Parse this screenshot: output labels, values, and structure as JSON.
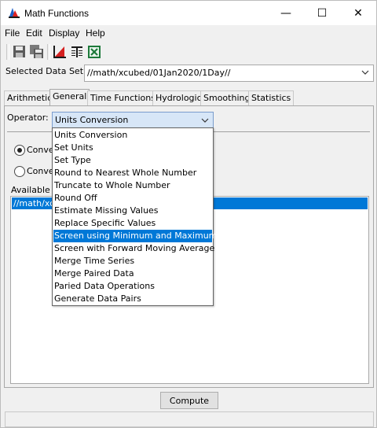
{
  "window": {
    "title": "Math Functions",
    "minimize": "—",
    "maximize": "☐",
    "close": "✕"
  },
  "menu": [
    "File",
    "Edit",
    "Display",
    "Help"
  ],
  "data_set": {
    "label": "Selected Data Set:",
    "value": "//math/xcubed/01Jan2020/1Day//"
  },
  "tabs": [
    {
      "label": "Arithmetic",
      "active": false
    },
    {
      "label": "General",
      "active": true
    },
    {
      "label": "Time Functions",
      "active": false
    },
    {
      "label": "Hydrologic",
      "active": false
    },
    {
      "label": "Smoothing",
      "active": false
    },
    {
      "label": "Statistics",
      "active": false
    }
  ],
  "operator": {
    "label": "Operator:",
    "value": "Units Conversion",
    "options": [
      "Units Conversion",
      "Set Units",
      "Set Type",
      "Round to Nearest Whole Number",
      "Truncate to Whole Number",
      "Round Off",
      "Estimate Missing Values",
      "Replace Specific Values",
      "Screen using Minimum and Maximum",
      "Screen with Forward Moving Average",
      "Merge Time Series",
      "Merge Paired Data",
      "Paried Data Operations",
      "Generate Data Pairs"
    ],
    "highlighted_index": 8
  },
  "radios": [
    {
      "label": "Conver",
      "selected": true
    },
    {
      "label": "Conver",
      "selected": false
    }
  ],
  "available": {
    "label": "Available D",
    "selected_item": "//math/xcub"
  },
  "compute_label": "Compute",
  "colors": {
    "selection": "#0078d7",
    "combo_focus": "#d7e6f7"
  }
}
